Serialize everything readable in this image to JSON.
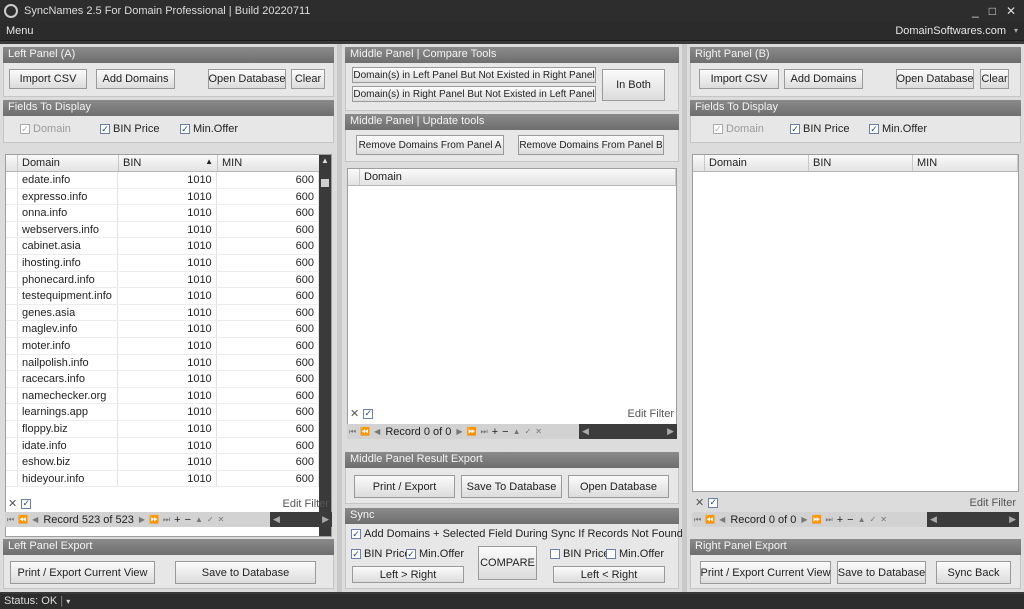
{
  "window": {
    "title": "SyncNames 2.5 For Domain Professional  |  Build 20220711",
    "minimize": "_",
    "maximize": "□",
    "close": "✕"
  },
  "menubar": {
    "menu": "Menu",
    "site": "DomainSoftwares.com",
    "dropdown": "▾"
  },
  "left": {
    "header": "Left Panel (A)",
    "import_csv": "Import CSV",
    "add_domains": "Add Domains",
    "open_database": "Open Database",
    "clear": "Clear",
    "fields_header": "Fields To Display",
    "field_domain": "Domain",
    "field_bin": "BIN Price",
    "field_min": "Min.Offer",
    "columns": [
      "Domain",
      "BIN",
      "MIN"
    ],
    "sort_arrow": "▲",
    "rows": [
      [
        "edate.info",
        "1010",
        "600"
      ],
      [
        "expresso.info",
        "1010",
        "600"
      ],
      [
        "onna.info",
        "1010",
        "600"
      ],
      [
        "webservers.info",
        "1010",
        "600"
      ],
      [
        "cabinet.asia",
        "1010",
        "600"
      ],
      [
        "ihosting.info",
        "1010",
        "600"
      ],
      [
        "phonecard.info",
        "1010",
        "600"
      ],
      [
        "testequipment.info",
        "1010",
        "600"
      ],
      [
        "genes.asia",
        "1010",
        "600"
      ],
      [
        "maglev.info",
        "1010",
        "600"
      ],
      [
        "moter.info",
        "1010",
        "600"
      ],
      [
        "nailpolish.info",
        "1010",
        "600"
      ],
      [
        "racecars.info",
        "1010",
        "600"
      ],
      [
        "namechecker.org",
        "1010",
        "600"
      ],
      [
        "learnings.app",
        "1010",
        "600"
      ],
      [
        "floppy.biz",
        "1010",
        "600"
      ],
      [
        "idate.info",
        "1010",
        "600"
      ],
      [
        "eshow.biz",
        "1010",
        "600"
      ],
      [
        "hideyour.info",
        "1010",
        "600"
      ]
    ],
    "edit_filter": "Edit Filter",
    "record": "Record 523 of 523",
    "export_header": "Left Panel Export",
    "print_export": "Print / Export Current View",
    "save_db": "Save to Database"
  },
  "middle": {
    "compare_header": "Middle Panel | Compare Tools",
    "left_not_right": "Domain(s) in Left Panel But Not Existed in Right Panel",
    "right_not_left": "Domain(s) in Right Panel But Not Existed in Left Panel",
    "in_both": "In Both",
    "update_header": "Middle Panel | Update tools",
    "remove_a": "Remove Domains From Panel A",
    "remove_b": "Remove Domains From Panel B",
    "column": "Domain",
    "edit_filter": "Edit Filter",
    "record": "Record 0 of 0",
    "export_header": "Middle Panel Result Export",
    "print_export": "Print / Export",
    "save_db": "Save To Database",
    "open_db": "Open Database",
    "sync_header": "Sync",
    "sync_add": "Add Domains + Selected Field During Sync If Records Not Found",
    "bin": "BIN Price",
    "min": "Min.Offer",
    "compare": "COMPARE",
    "left_right": "Left > Right",
    "right_left": "Left < Right"
  },
  "right": {
    "header": "Right Panel (B)",
    "import_csv": "Import CSV",
    "add_domains": "Add Domains",
    "open_database": "Open Database",
    "clear": "Clear",
    "fields_header": "Fields To Display",
    "field_domain": "Domain",
    "field_bin": "BIN Price",
    "field_min": "Min.Offer",
    "columns": [
      "Domain",
      "BIN",
      "MIN"
    ],
    "edit_filter": "Edit Filter",
    "record": "Record 0 of 0",
    "export_header": "Right Panel Export",
    "print_export": "Print / Export Current View",
    "save_db": "Save to Database",
    "sync_back": "Sync Back"
  },
  "status": {
    "text": "Status: OK",
    "dropdown": "▾"
  }
}
